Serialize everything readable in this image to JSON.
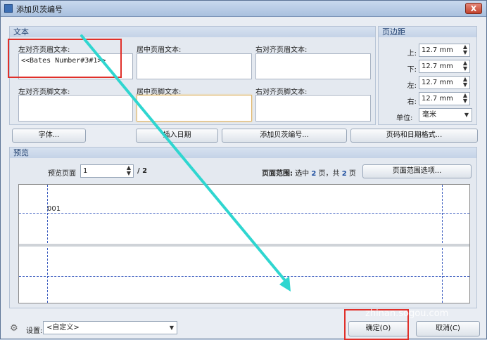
{
  "window": {
    "title": "添加贝茨编号",
    "close_label": "X"
  },
  "text_group": {
    "title": "文本",
    "header_left_label": "左对齐页眉文本:",
    "header_left_value": "<<Bates Number#3#1>>",
    "header_center_label": "居中页眉文本:",
    "header_right_label": "右对齐页眉文本:",
    "footer_left_label": "左对齐页脚文本:",
    "footer_center_label": "居中页脚文本:",
    "footer_right_label": "右对齐页脚文本:"
  },
  "margins_group": {
    "title": "页边距",
    "top_label": "上:",
    "top_value": "12.7 mm",
    "bottom_label": "下:",
    "bottom_value": "12.7 mm",
    "left_label": "左:",
    "left_value": "12.7 mm",
    "right_label": "右:",
    "right_value": "12.7 mm",
    "unit_label": "单位:",
    "unit_value": "毫米"
  },
  "buttons": {
    "font": "字体...",
    "insert_date": "插入日期",
    "add_bates": "添加贝茨编号...",
    "page_date_format": "页码和日期格式..."
  },
  "preview_group": {
    "title": "预览",
    "preview_page_label": "预览页面",
    "preview_page_value": "1",
    "page_total": "/ 2",
    "range_label": "页面范围:",
    "range_prefix": "选中",
    "range_selected": "2",
    "range_mid": "页，共",
    "range_total": "2",
    "range_suffix": "页",
    "range_options": "页面范围选项...",
    "sample_text": "001"
  },
  "footer": {
    "settings_label": "设置:",
    "settings_value": "<自定义>",
    "ok": "确定(O)",
    "cancel": "取消(C)"
  },
  "watermark": {
    "glyph": "S",
    "brand": "搜狗指南",
    "url": "zhinan.sogou.com"
  }
}
